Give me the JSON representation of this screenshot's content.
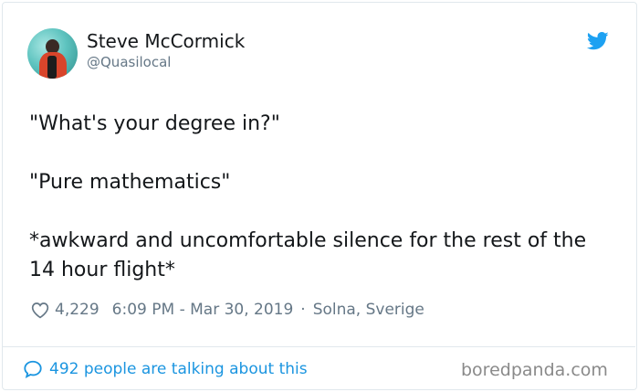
{
  "author": {
    "name": "Steve McCormick",
    "handle": "@Quasilocal"
  },
  "tweet": {
    "paragraphs": [
      "\"What's your degree in?\"",
      "\"Pure mathematics\"",
      "*awkward and uncomfortable silence for the rest of the 14 hour flight*"
    ]
  },
  "meta": {
    "likes": "4,229",
    "time": "6:09 PM - Mar 30, 2019",
    "separator": "·",
    "location": "Solna, Sverige"
  },
  "footer": {
    "talking": "492 people are talking about this",
    "watermark": "boredpanda.com"
  },
  "icons": {
    "bird": "twitter-bird-icon",
    "heart": "heart-icon",
    "bubble": "speech-bubble-icon"
  },
  "colors": {
    "twitter_blue": "#1da1f2",
    "link_blue": "#1b95e0",
    "secondary_text": "#657786",
    "primary_text": "#14171a",
    "border": "#e1e8ed"
  }
}
